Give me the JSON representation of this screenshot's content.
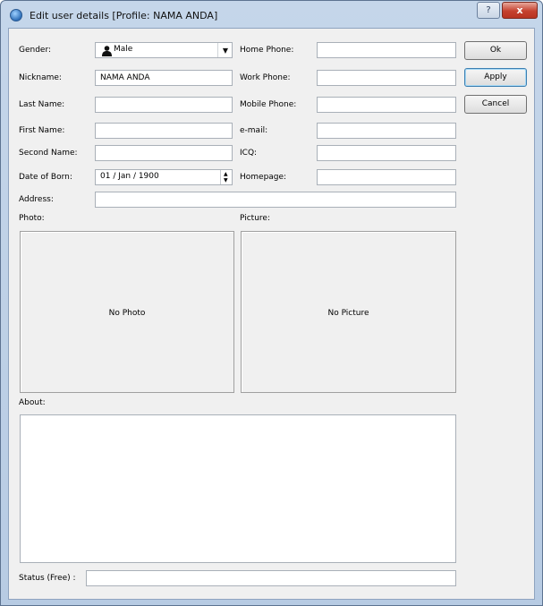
{
  "window": {
    "title": "Edit user details [Profile: NAMA ANDA]",
    "help_glyph": "?",
    "close_glyph": "x"
  },
  "labels": {
    "gender": "Gender:",
    "nickname": "Nickname:",
    "last_name": "Last Name:",
    "first_name": "First Name:",
    "second_name": "Second Name:",
    "date_of_born": "Date of Born:",
    "address": "Address:",
    "photo": "Photo:",
    "picture": "Picture:",
    "about": "About:",
    "status": "Status (Free) :",
    "home_phone": "Home Phone:",
    "work_phone": "Work Phone:",
    "mobile_phone": "Mobile Phone:",
    "email": "e-mail:",
    "icq": "ICQ:",
    "homepage": "Homepage:"
  },
  "values": {
    "gender": "Male",
    "nickname": "NAMA ANDA",
    "last_name": "",
    "first_name": "",
    "second_name": "",
    "date_of_born": "01 / Jan / 1900",
    "address": "",
    "home_phone": "",
    "work_phone": "",
    "mobile_phone": "",
    "email": "",
    "icq": "",
    "homepage": "",
    "status": ""
  },
  "placeholders": {
    "photo": "No Photo",
    "picture": "No Picture"
  },
  "buttons": {
    "ok": "Ok",
    "apply": "Apply",
    "cancel": "Cancel"
  },
  "icons": {
    "app": "globe-icon",
    "gender": "person-icon",
    "dropdown": "chevron-down-icon"
  }
}
